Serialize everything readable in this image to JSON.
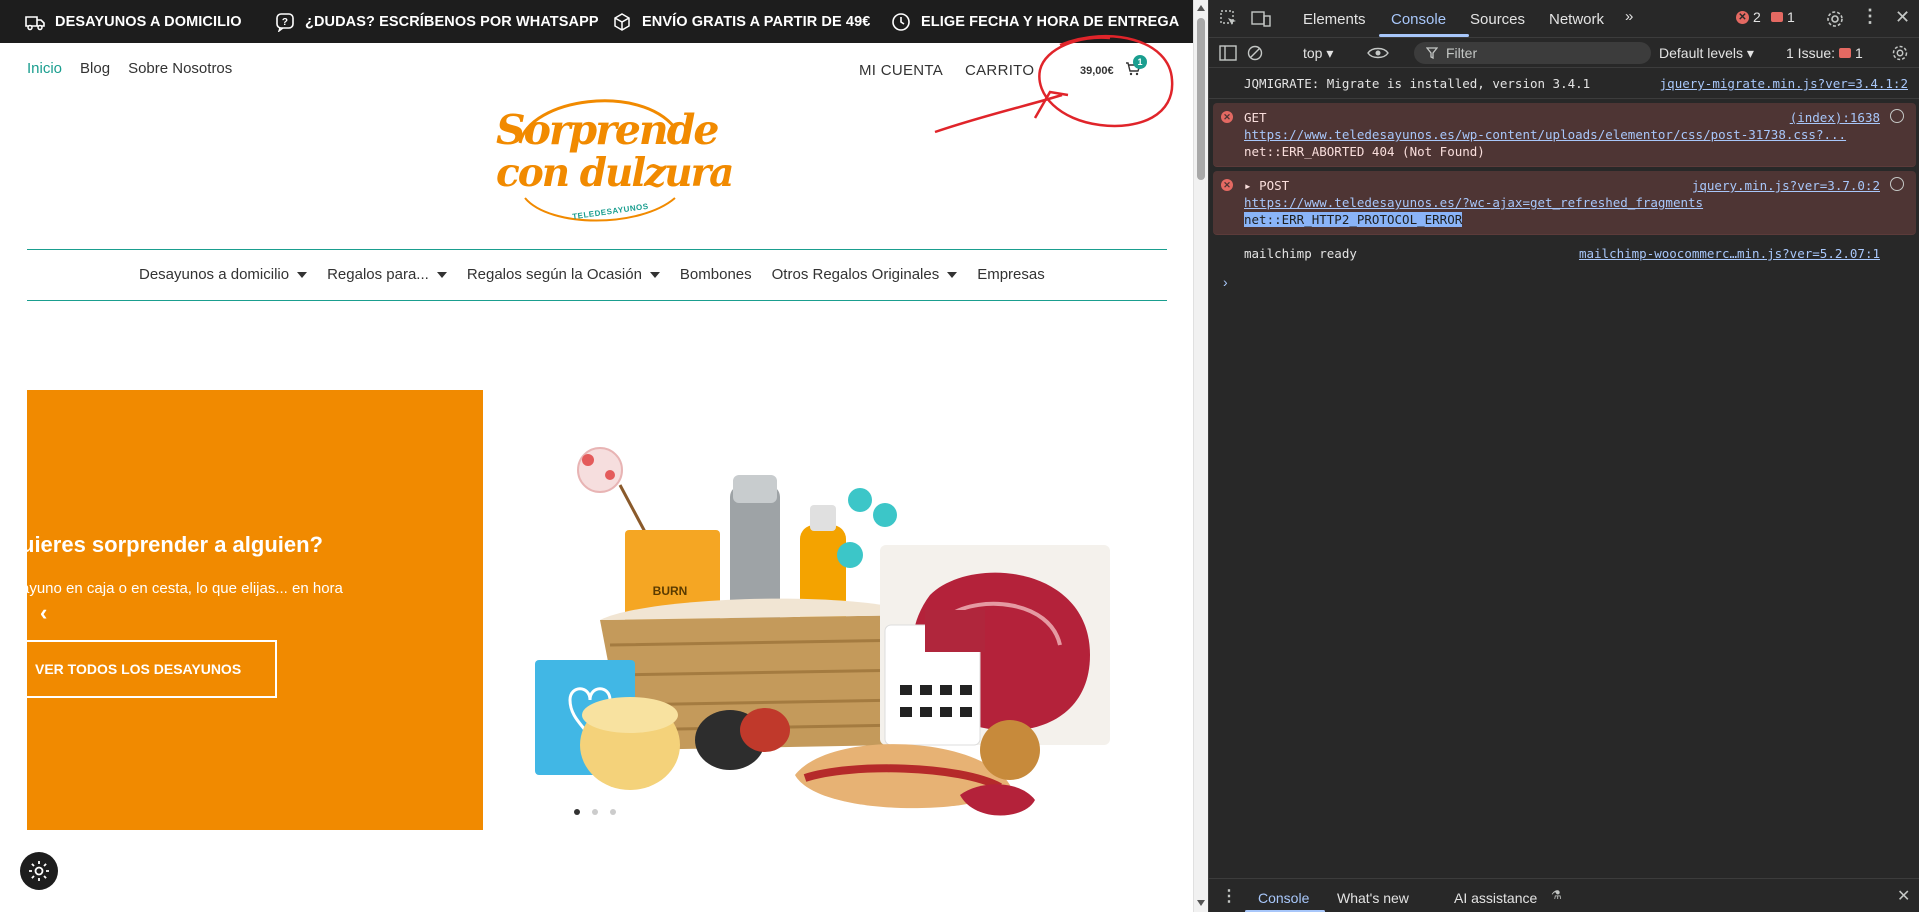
{
  "site": {
    "topbar": [
      {
        "label": "DESAYUNOS A DOMICILIO",
        "icon": "delivery-truck-icon"
      },
      {
        "label": "¿DUDAS? ESCRÍBENOS POR WHATSAPP",
        "icon": "question-bubble-icon"
      },
      {
        "label": "ENVÍO GRATIS A PARTIR DE 49€",
        "icon": "box-icon"
      },
      {
        "label": "ELIGE FECHA Y HORA DE ENTREGA",
        "icon": "clock-icon"
      }
    ],
    "header_links": [
      "Inicio",
      "Blog",
      "Sobre Nosotros"
    ],
    "mi_cuenta": "MI CUENTA",
    "carrito": "CARRITO",
    "cart_total": "39,00€",
    "cart_count": "1",
    "logo": {
      "line1": "Sorprende",
      "line2": "con dulzura",
      "sub": "TELEDESAYUNOS",
      "color": "#f18a00"
    },
    "nav": [
      {
        "label": "Desayunos a domicilio",
        "dropdown": true
      },
      {
        "label": "Regalos para...",
        "dropdown": true
      },
      {
        "label": "Regalos según la Ocasión",
        "dropdown": true
      },
      {
        "label": "Bombones",
        "dropdown": false
      },
      {
        "label": "Otros Regalos Originales",
        "dropdown": true
      },
      {
        "label": "Empresas",
        "dropdown": false
      }
    ],
    "hero": {
      "title": "uieres sorprender a alguien?",
      "subtitle": "ayuno en caja o en cesta, lo que elijas... en hora",
      "button": "VER TODOS LOS DESAYUNOS",
      "prev_arrow": "‹",
      "next_arrow": "›",
      "slide_count": 3,
      "active_slide": 1
    },
    "accent": "#1a9e8f"
  },
  "devtools": {
    "tabs": [
      "Elements",
      "Console",
      "Sources",
      "Network"
    ],
    "active_tab": "Console",
    "error_count": "2",
    "issue_count": "1",
    "context": "top",
    "filter_placeholder": "Filter",
    "levels": "Default levels",
    "issues_label": "1 Issue:",
    "issues_count": "1",
    "messages": [
      {
        "type": "log",
        "text": "JQMIGRATE: Migrate is installed, version 3.4.1",
        "source": "jquery-migrate.min.js?ver=3.4.1:2"
      },
      {
        "type": "error",
        "method": "GET",
        "url": "https://www.teledesayunos.es/wp-content/uploads/elementor/css/post-31738.css?...",
        "detail": "net::ERR_ABORTED 404 (Not Found)",
        "source": "(index):1638"
      },
      {
        "type": "error",
        "method": "POST",
        "url": "https://www.teledesayunos.es/?wc-ajax=get_refreshed_fragments",
        "detail": "net::ERR_HTTP2_PROTOCOL_ERROR",
        "source": "jquery.min.js?ver=3.7.0:2"
      },
      {
        "type": "log",
        "text": "mailchimp ready",
        "source": "mailchimp-woocommerc…min.js?ver=5.2.07:1"
      }
    ],
    "drawer_tabs": [
      "Console",
      "What's new",
      "AI assistance"
    ]
  }
}
